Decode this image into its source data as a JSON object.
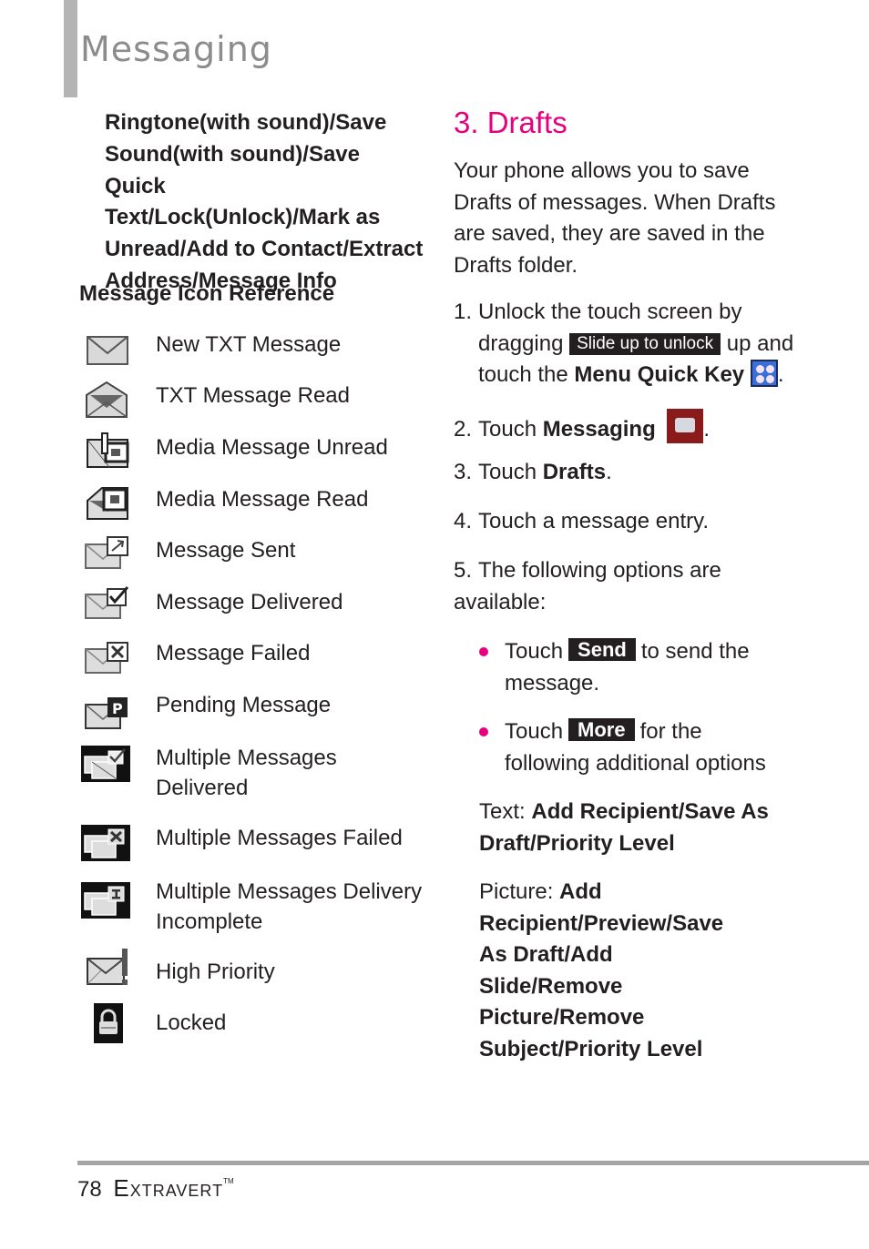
{
  "header": {
    "title": "Messaging"
  },
  "left": {
    "options_text": "Ringtone(with sound)/Save Sound(with sound)/Save Quick Text/Lock(Unlock)/Mark as Unread/Add to Contact/Extract Address/Message Info",
    "options_lines": [
      "Ringtone(with sound)/Save",
      "Sound(with sound)/Save Quick",
      "Text/Lock(Unlock)/Mark as",
      "Unread/Add to Contact/Extract",
      "Address/Message Info"
    ],
    "icon_reference_title": "Message Icon Reference",
    "icons": [
      {
        "icon": "envelope-closed-icon",
        "label": "New TXT Message"
      },
      {
        "icon": "envelope-open-icon",
        "label": "TXT Message Read"
      },
      {
        "icon": "media-envelope-unread-icon",
        "label": "Media Message Unread"
      },
      {
        "icon": "media-envelope-read-icon",
        "label": "Media Message Read"
      },
      {
        "icon": "message-sent-icon",
        "label": "Message Sent"
      },
      {
        "icon": "message-delivered-icon",
        "label": "Message Delivered"
      },
      {
        "icon": "message-failed-icon",
        "label": "Message Failed"
      },
      {
        "icon": "pending-message-icon",
        "label": "Pending Message"
      },
      {
        "icon": "multiple-delivered-icon",
        "label": "Multiple Messages Delivered"
      },
      {
        "icon": "multiple-failed-icon",
        "label": "Multiple Messages Failed"
      },
      {
        "icon": "multiple-incomplete-icon",
        "label": "Multiple Messages Delivery Incomplete"
      },
      {
        "icon": "high-priority-icon",
        "label": "High Priority"
      },
      {
        "icon": "lock-icon",
        "label": "Locked"
      }
    ]
  },
  "right": {
    "section_title": "3. Drafts",
    "intro": "Your phone allows you to save Drafts of messages. When Drafts are saved, they are saved in the Drafts folder.",
    "steps": [
      {
        "num": "1.",
        "pre": "Unlock the touch screen by dragging",
        "chip": "Slide up to unlock",
        "mid": "up and touch the",
        "bold": "Menu Quick Key",
        "icon": "menu-quick-key-icon",
        "post": "."
      },
      {
        "num": "2.",
        "pre": "Touch",
        "bold": "Messaging",
        "icon": "messaging-icon",
        "post": "."
      },
      {
        "num": "3.",
        "pre": "Touch",
        "bold": "Drafts",
        "post": "."
      },
      {
        "num": "4.",
        "pre": "Touch a message entry."
      },
      {
        "num": "5.",
        "pre": "The following options are available:"
      }
    ],
    "bullets": [
      {
        "pre": "Touch",
        "chip": "Send",
        "post": "to send the message."
      },
      {
        "pre": "Touch",
        "chip": "More",
        "post": "for the following additional options"
      }
    ],
    "text_options": {
      "label": "Text:",
      "value": "Add Recipient/Save As Draft/Priority Level"
    },
    "picture_options": {
      "label": "Picture:",
      "value": "Add Recipient/Preview/Save As Draft/Add Slide/Remove Picture/Remove Subject/Priority Level"
    }
  },
  "footer": {
    "page_number": "78",
    "brand": "Extravert",
    "trademark": "TM"
  },
  "colors": {
    "accent": "#e6007e",
    "header_gray": "#8c8c8c",
    "bar_gray": "#b4b4b4",
    "text": "#231f20"
  }
}
